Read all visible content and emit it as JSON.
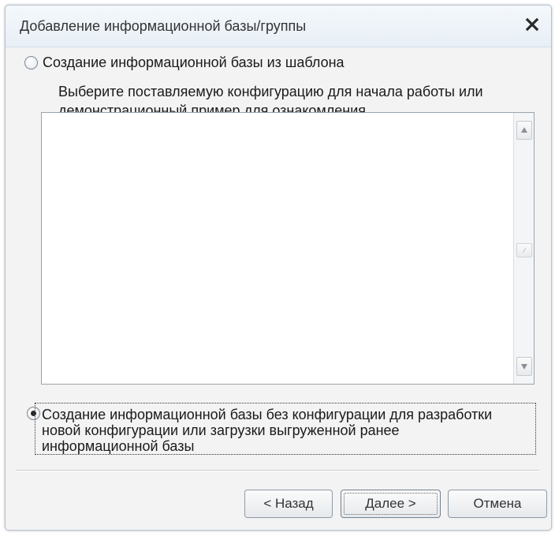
{
  "dialog": {
    "title": "Добавление информационной базы/группы",
    "close_icon": "close-icon"
  },
  "option_template": {
    "label": "Создание информационной базы из шаблона",
    "selected": false,
    "description_line1": "Выберите поставляемую конфигурацию для начала работы или",
    "description_line2": "демонстрационный пример для ознакомления",
    "list_items": []
  },
  "option_empty": {
    "selected": true,
    "line1": "Создание информационной базы без конфигурации для разработки",
    "line2": "новой конфигурации или загрузки выгруженной ранее",
    "line3": "информационной базы"
  },
  "buttons": {
    "back": "< Назад",
    "next": "Далее >",
    "cancel": "Отмена"
  }
}
